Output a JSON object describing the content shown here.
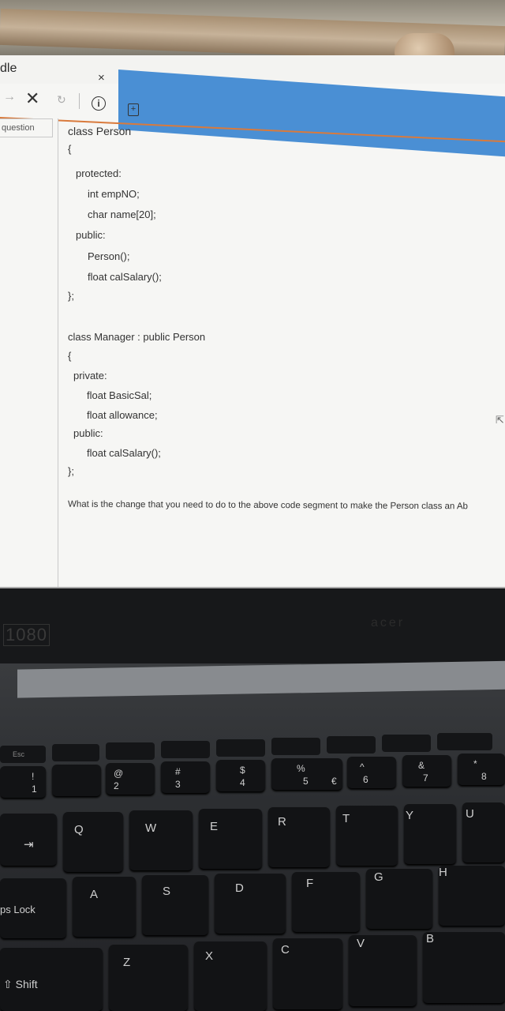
{
  "window": {
    "title": "dle",
    "tab_close": "×"
  },
  "toolbar": {
    "back": "→",
    "stop": "✕",
    "reload": "↻",
    "info": "i",
    "save": "+"
  },
  "side_panel": {
    "tab_label": "question"
  },
  "code_lines": [
    "class Person",
    "{",
    "protected:",
    "int empNO;",
    "char name[20];",
    "public:",
    "Person();",
    "float calSalary();",
    "};",
    "class Manager : public Person",
    "{",
    "private:",
    "float BasicSal;",
    "float allowance;",
    "public:",
    "float calSalary();",
    "};"
  ],
  "question": "What is the change that you need to do to the above code segment to make the Person class an Ab",
  "laptop": {
    "hd_badge": "1080",
    "brand": "acer"
  },
  "keyboard": {
    "esc": "Esc",
    "number_row": [
      {
        "top": "!",
        "bottom": "1"
      },
      {
        "top": "@",
        "bottom": "2"
      },
      {
        "top": "#",
        "bottom": "3"
      },
      {
        "top": "$",
        "bottom": "4"
      },
      {
        "top": "%",
        "bottom": "5",
        "extra": "€"
      },
      {
        "top": "^",
        "bottom": "6"
      },
      {
        "top": "&",
        "bottom": "7"
      },
      {
        "top": "*",
        "bottom": "8"
      }
    ],
    "qwerty": [
      "Q",
      "W",
      "E",
      "R",
      "T",
      "Y",
      "U"
    ],
    "home": [
      "A",
      "S",
      "D",
      "F",
      "G",
      "H"
    ],
    "bottom": [
      "Z",
      "X",
      "C",
      "V",
      "B"
    ],
    "tab": "⇥",
    "caps": "ps Lock",
    "shift": "⇧ Shift"
  }
}
